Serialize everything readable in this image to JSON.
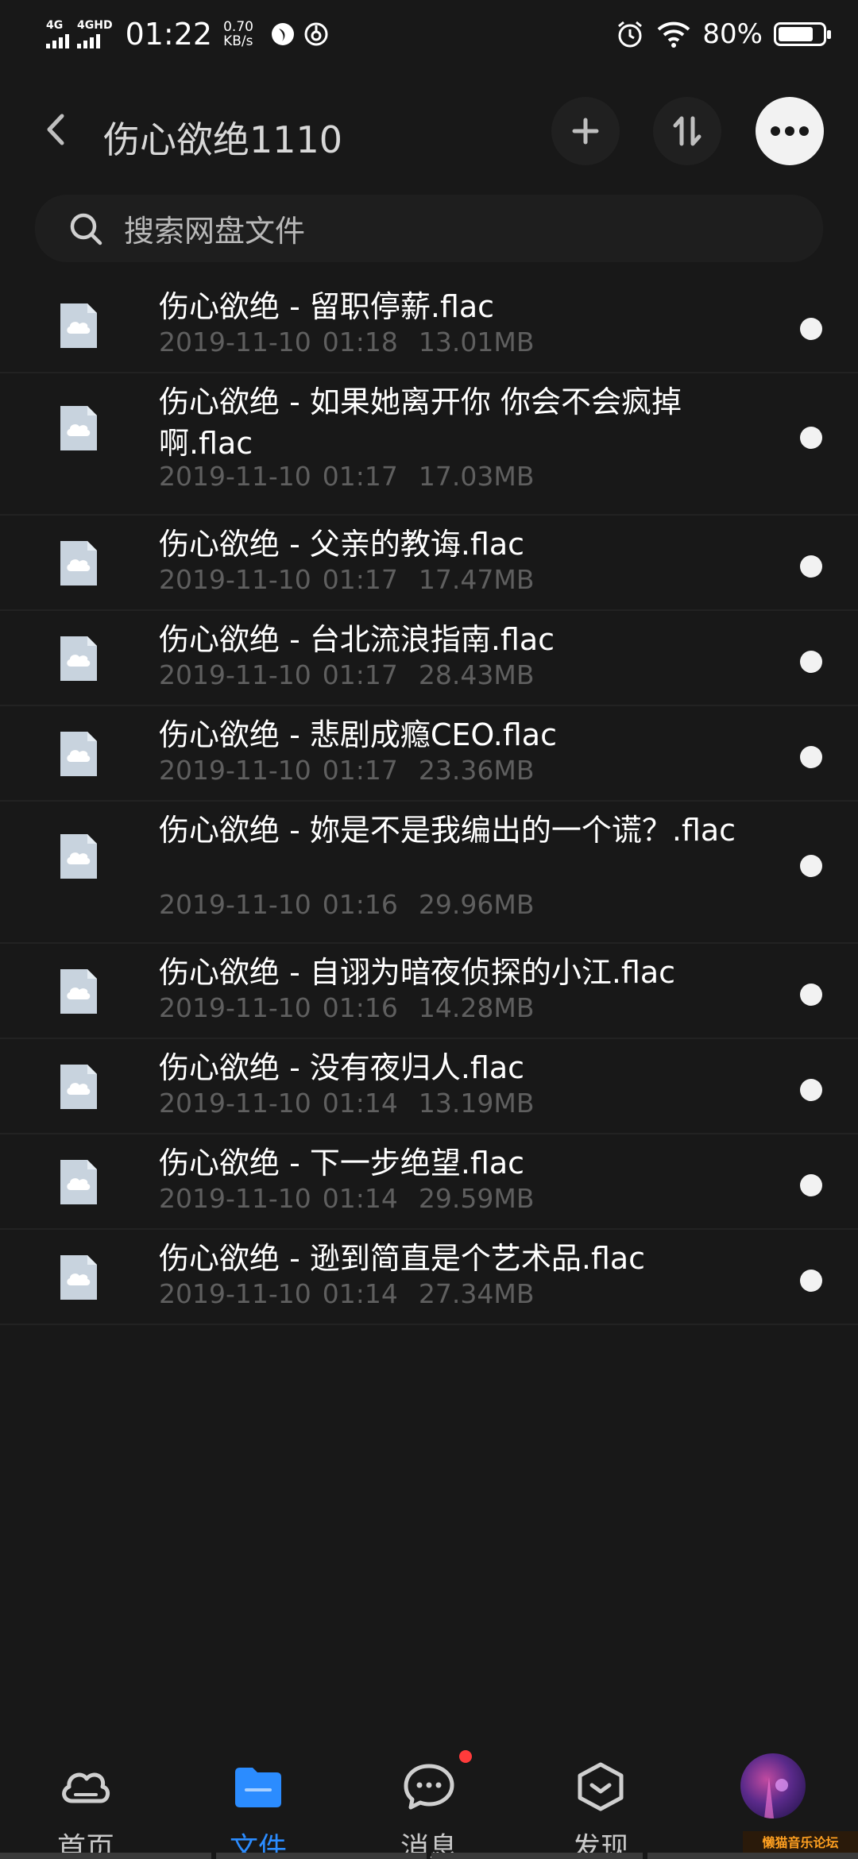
{
  "status_bar": {
    "net1": "4G",
    "net2": "4GHD",
    "time": "01:22",
    "speed_value": "0.70",
    "speed_unit": "KB/s",
    "battery": "80%",
    "battery_level": 0.8
  },
  "header": {
    "title": "伤心欲绝1110"
  },
  "search": {
    "placeholder": "搜索网盘文件"
  },
  "files": [
    {
      "name": "伤心欲绝 - 留职停薪.flac",
      "date": "2019-11-10",
      "time": "01:18",
      "size": "13.01MB"
    },
    {
      "name": "伤心欲绝 - 如果她离开你 你会不会疯掉啊.flac",
      "date": "2019-11-10",
      "time": "01:17",
      "size": "17.03MB"
    },
    {
      "name": "伤心欲绝 - 父亲的教诲.flac",
      "date": "2019-11-10",
      "time": "01:17",
      "size": "17.47MB"
    },
    {
      "name": "伤心欲绝 - 台北流浪指南.flac",
      "date": "2019-11-10",
      "time": "01:17",
      "size": "28.43MB"
    },
    {
      "name": "伤心欲绝 - 悲剧成瘾CEO.flac",
      "date": "2019-11-10",
      "time": "01:17",
      "size": "23.36MB"
    },
    {
      "name": "伤心欲绝 - 妳是不是我编出的一个谎？.flac",
      "date": "2019-11-10",
      "time": "01:16",
      "size": "29.96MB"
    },
    {
      "name": "伤心欲绝 - 自诩为暗夜侦探的小江.flac",
      "date": "2019-11-10",
      "time": "01:16",
      "size": "14.28MB"
    },
    {
      "name": "伤心欲绝 - 没有夜归人.flac",
      "date": "2019-11-10",
      "time": "01:14",
      "size": "13.19MB"
    },
    {
      "name": "伤心欲绝 - 下一步绝望.flac",
      "date": "2019-11-10",
      "time": "01:14",
      "size": "29.59MB"
    },
    {
      "name": "伤心欲绝 - 逊到简直是个艺术品.flac",
      "date": "2019-11-10",
      "time": "01:14",
      "size": "27.34MB"
    }
  ],
  "bottom_nav": [
    {
      "label": "首页",
      "icon": "cloud-icon"
    },
    {
      "label": "文件",
      "icon": "folder-icon",
      "active": true
    },
    {
      "label": "消息",
      "icon": "message-icon"
    },
    {
      "label": "发现",
      "icon": "discover-icon"
    }
  ],
  "watermark": "懒猫音乐论坛",
  "colors": {
    "background": "#181818",
    "accent": "#2b8cff",
    "meta_text": "#5f5f5f",
    "badge": "#ff3b3b"
  }
}
